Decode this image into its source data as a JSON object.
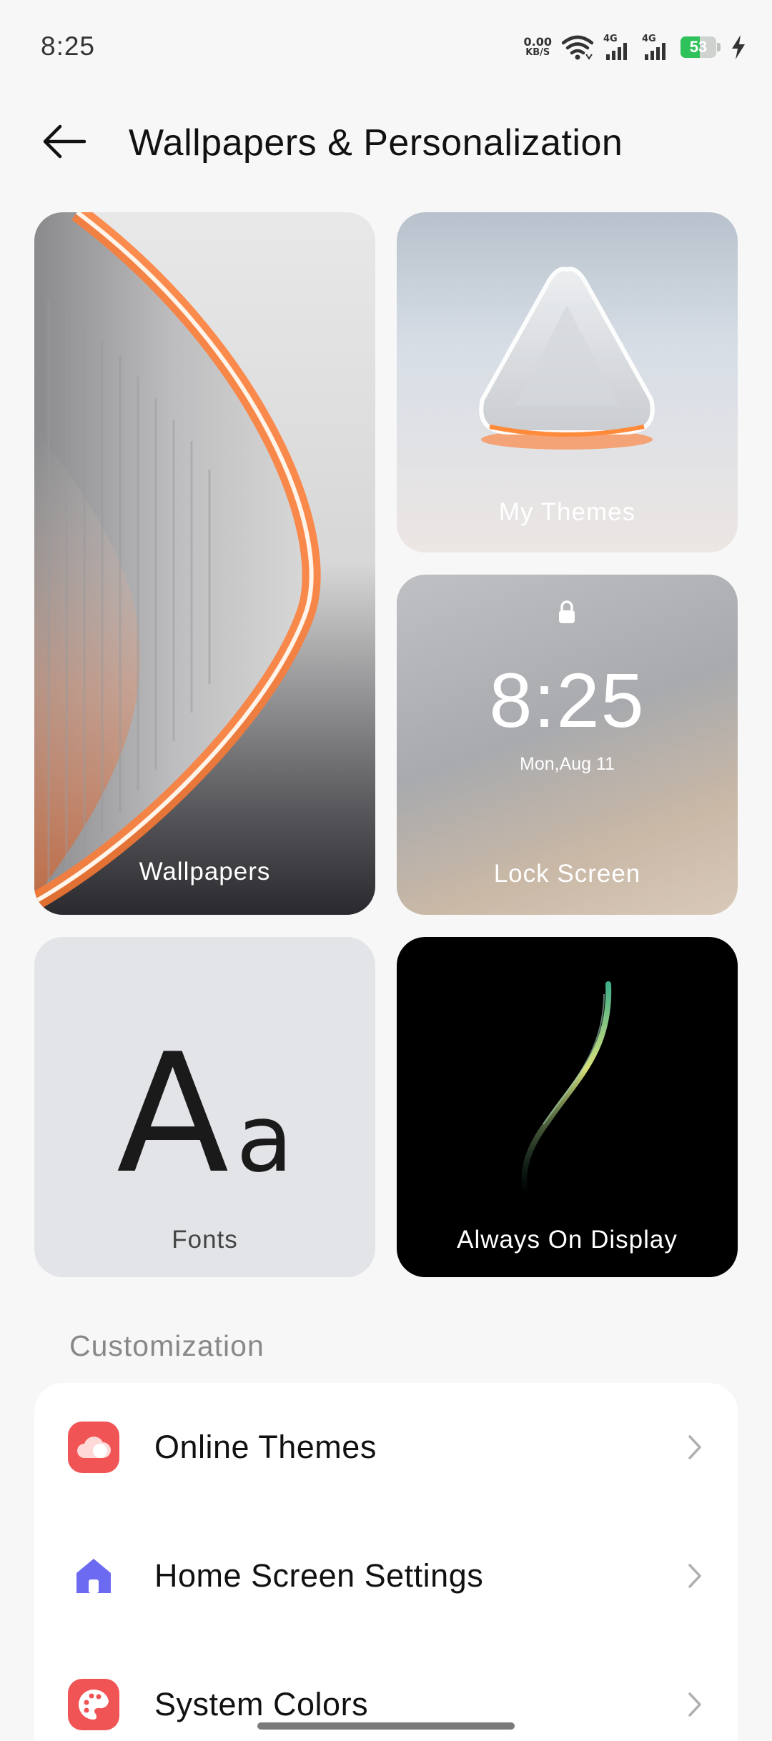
{
  "status_bar": {
    "time": "8:25",
    "net_speed_value": "0.00",
    "net_speed_unit": "KB/S",
    "signal_1_label": "4G",
    "signal_2_label": "4G",
    "battery_level": "53",
    "battery_fraction": 0.53,
    "battery_color": "#2fc25b",
    "icons": [
      "wifi-icon",
      "signal-icon",
      "signal-icon",
      "battery-icon",
      "charging-icon"
    ]
  },
  "header": {
    "back_icon": "arrow-left-icon",
    "title": "Wallpapers & Personalization"
  },
  "cards": {
    "wallpapers": {
      "label": "Wallpapers"
    },
    "my_themes": {
      "label": "My Themes"
    },
    "lock_screen": {
      "label": "Lock Screen",
      "time": "8:25",
      "date": "Mon,Aug 11",
      "icon": "lock-icon"
    },
    "fonts": {
      "label": "Fonts",
      "sample_upper": "A",
      "sample_lower": "a"
    },
    "always_on_display": {
      "label": "Always On Display"
    }
  },
  "customization": {
    "section_title": "Customization",
    "items": [
      {
        "label": "Online Themes",
        "icon": "cloud-icon",
        "icon_bg": "#f05454"
      },
      {
        "label": "Home Screen Settings",
        "icon": "home-icon",
        "icon_bg": "#ffffff"
      },
      {
        "label": "System Colors",
        "icon": "palette-icon",
        "icon_bg": "#f05454"
      }
    ]
  },
  "colors": {
    "accent_orange": "#f06a28",
    "home_icon": "#6b6af0",
    "chevron": "#b0b0b0"
  }
}
